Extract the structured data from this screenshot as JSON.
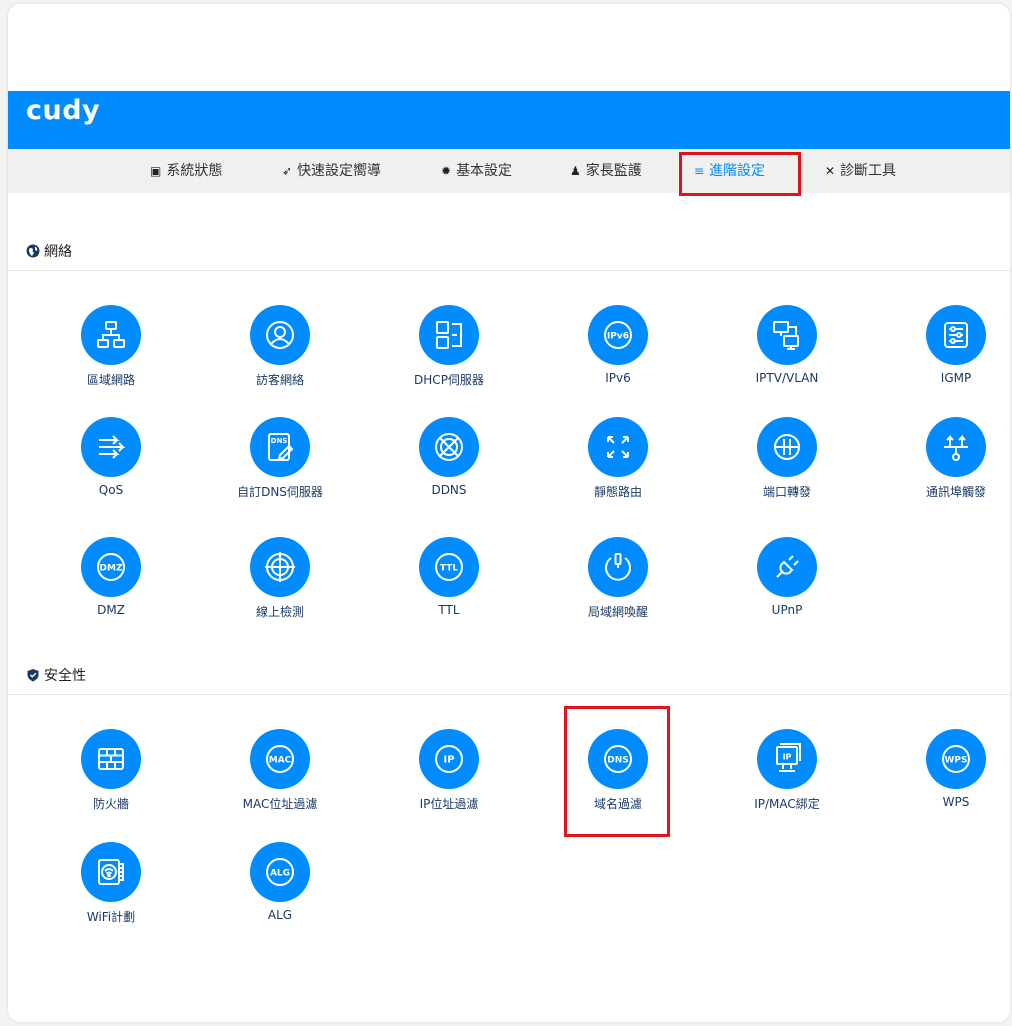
{
  "brand": {
    "logo": "cudy",
    "color": "#008cff"
  },
  "nav": {
    "items": [
      {
        "label": "系統狀態",
        "icon": "monitor-icon",
        "glyph": "▣"
      },
      {
        "label": "快速設定嚮導",
        "icon": "rocket-icon",
        "glyph": "➶"
      },
      {
        "label": "基本設定",
        "icon": "gear-icon",
        "glyph": "✹"
      },
      {
        "label": "家長監護",
        "icon": "family-icon",
        "glyph": "♟"
      },
      {
        "label": "進階設定",
        "icon": "advanced-settings-icon",
        "glyph": "≡"
      },
      {
        "label": "診斷工具",
        "icon": "tools-icon",
        "glyph": "✕"
      }
    ],
    "active_index": 4
  },
  "sections": {
    "network": {
      "title": "網絡",
      "icon": "globe-icon",
      "items": [
        {
          "label": "區域網路",
          "icon": "lan-topology-icon"
        },
        {
          "label": "訪客網絡",
          "icon": "guest-user-icon"
        },
        {
          "label": "DHCP伺服器",
          "icon": "dhcp-server-icon"
        },
        {
          "label": "IPv6",
          "icon": "ipv6-icon",
          "glyph": "IPv6"
        },
        {
          "label": "IPTV/VLAN",
          "icon": "iptv-vlan-icon"
        },
        {
          "label": "IGMP",
          "icon": "igmp-sliders-icon"
        },
        {
          "label": "QoS",
          "icon": "qos-arrows-icon"
        },
        {
          "label": "自訂DNS伺服器",
          "icon": "custom-dns-icon",
          "glyph": "DNS"
        },
        {
          "label": "DDNS",
          "icon": "ddns-globe-icon"
        },
        {
          "label": "靜態路由",
          "icon": "static-route-icon"
        },
        {
          "label": "端口轉發",
          "icon": "port-forward-icon"
        },
        {
          "label": "通訊埠觸發",
          "icon": "port-trigger-icon"
        },
        {
          "label": "DMZ",
          "icon": "dmz-icon",
          "glyph": "DMZ"
        },
        {
          "label": "線上檢測",
          "icon": "online-detect-icon"
        },
        {
          "label": "TTL",
          "icon": "ttl-icon",
          "glyph": "TTL"
        },
        {
          "label": "局域網喚醒",
          "icon": "wake-on-lan-icon"
        },
        {
          "label": "UPnP",
          "icon": "upnp-plug-icon"
        }
      ]
    },
    "security": {
      "title": "安全性",
      "icon": "shield-icon",
      "items": [
        {
          "label": "防火牆",
          "icon": "firewall-icon"
        },
        {
          "label": "MAC位址過濾",
          "icon": "mac-filter-icon",
          "glyph": "MAC"
        },
        {
          "label": "IP位址過濾",
          "icon": "ip-filter-icon",
          "glyph": "IP"
        },
        {
          "label": "域名過濾",
          "icon": "domain-filter-icon",
          "glyph": "DNS"
        },
        {
          "label": "IP/MAC綁定",
          "icon": "ip-mac-binding-icon",
          "glyph": "IP"
        },
        {
          "label": "WPS",
          "icon": "wps-icon",
          "glyph": "WPS"
        },
        {
          "label": "WiFi計劃",
          "icon": "wifi-schedule-icon"
        },
        {
          "label": "ALG",
          "icon": "alg-icon",
          "glyph": "ALG"
        }
      ]
    }
  },
  "highlight": {
    "color": "#e0141e"
  }
}
